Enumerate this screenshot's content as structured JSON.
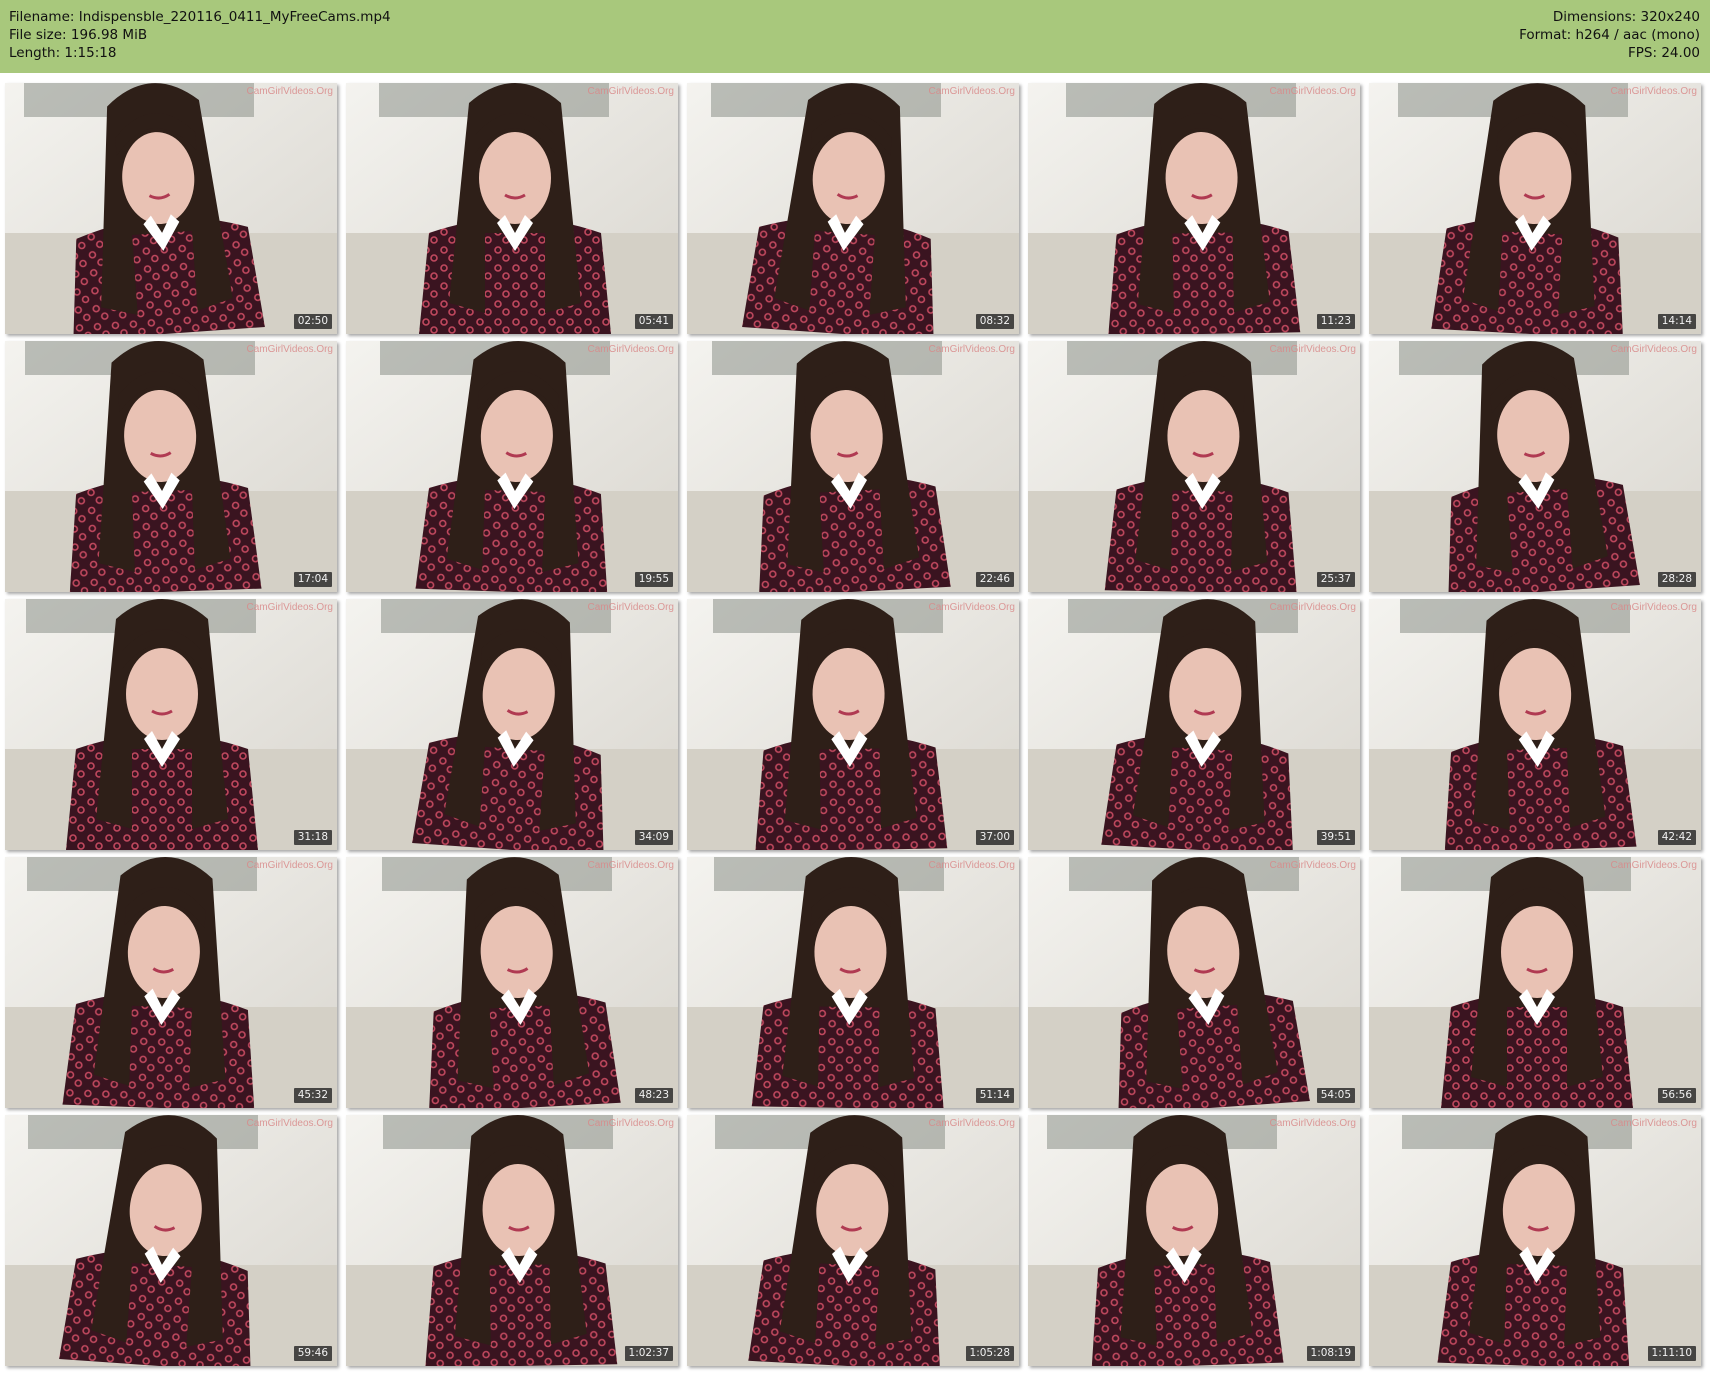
{
  "header": {
    "filename_line": "Filename: Indispensble_220116_0411_MyFreeCams.mp4",
    "filesize_line": "File size: 196.98 MiB",
    "length_line": "Length: 1:15:18",
    "dimensions_line": "Dimensions: 320x240",
    "format_line": "Format: h264 / aac (mono)",
    "fps_line": "FPS: 24.00"
  },
  "watermark": "CamGirlVideos.Org",
  "colors": {
    "header_bg": "#a8c87c",
    "page_bg": "#ffffff",
    "timestamp_bg": "#1e1e1e"
  },
  "thumbnails": [
    {
      "timestamp": "02:50"
    },
    {
      "timestamp": "05:41"
    },
    {
      "timestamp": "08:32"
    },
    {
      "timestamp": "11:23"
    },
    {
      "timestamp": "14:14"
    },
    {
      "timestamp": "17:04"
    },
    {
      "timestamp": "19:55"
    },
    {
      "timestamp": "22:46"
    },
    {
      "timestamp": "25:37"
    },
    {
      "timestamp": "28:28"
    },
    {
      "timestamp": "31:18"
    },
    {
      "timestamp": "34:09"
    },
    {
      "timestamp": "37:00"
    },
    {
      "timestamp": "39:51"
    },
    {
      "timestamp": "42:42"
    },
    {
      "timestamp": "45:32"
    },
    {
      "timestamp": "48:23"
    },
    {
      "timestamp": "51:14"
    },
    {
      "timestamp": "54:05"
    },
    {
      "timestamp": "56:56"
    },
    {
      "timestamp": "59:46"
    },
    {
      "timestamp": "1:02:37"
    },
    {
      "timestamp": "1:05:28"
    },
    {
      "timestamp": "1:08:19"
    },
    {
      "timestamp": "1:11:10"
    }
  ]
}
